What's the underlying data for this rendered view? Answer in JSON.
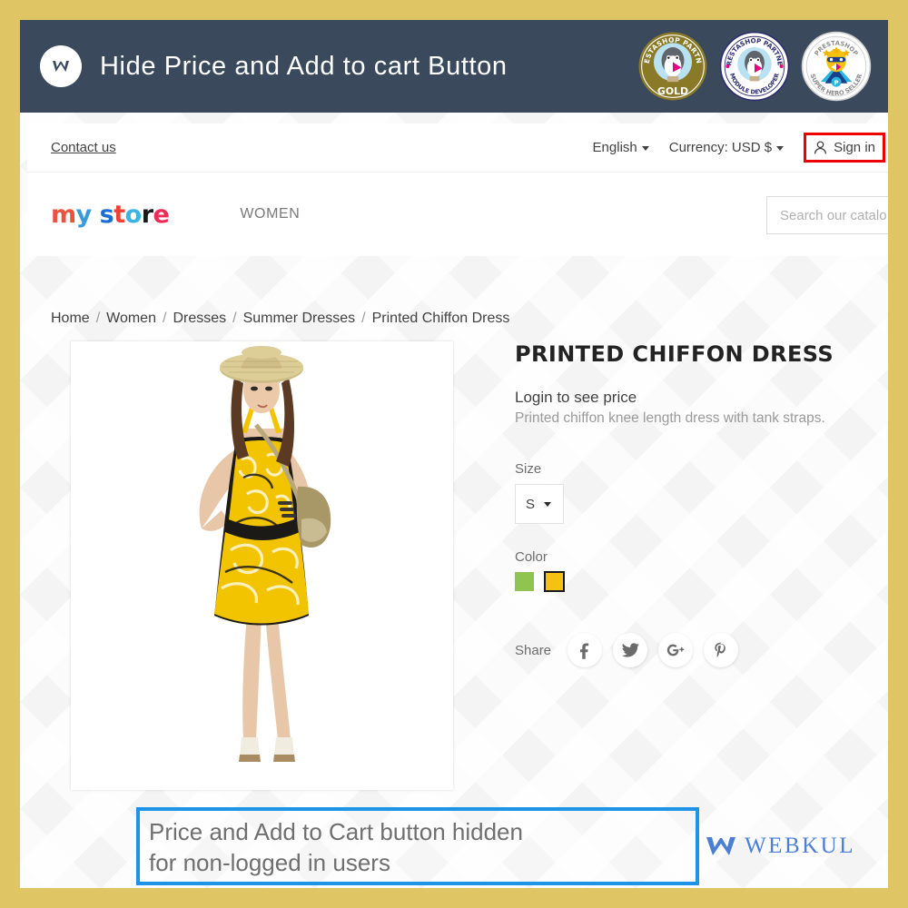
{
  "banner": {
    "title": "Hide Price and Add to cart Button",
    "logo_icon": "webkul-mark-icon",
    "badges": [
      {
        "name": "prestashop-partner-gold-badge",
        "line1": "PRESTASHOP PARTNER",
        "line2": "GOLD"
      },
      {
        "name": "prestashop-partner-module-developer-badge",
        "line1": "PRESTASHOP PARTNER",
        "line2": "MODULE DEVELOPER"
      },
      {
        "name": "prestashop-super-hero-seller-badge",
        "line1": "PRESTASHOP",
        "line2": "SUPER HERO SELLER"
      }
    ],
    "background_color": "#3a4a5c"
  },
  "frame": {
    "border_color": "#e0c565"
  },
  "topbar": {
    "contact_us": "Contact us",
    "language": "English",
    "currency": "Currency: USD $",
    "sign_in": "Sign in",
    "sign_in_highlight_color": "#ee0000"
  },
  "navrow": {
    "logo": {
      "full": "my store",
      "letters": [
        "m",
        "y",
        "s",
        "t",
        "o",
        "r",
        "e"
      ]
    },
    "menu": [
      "WOMEN"
    ],
    "search": {
      "placeholder": "Search our catalo",
      "value": ""
    }
  },
  "breadcrumb": {
    "items": [
      "Home",
      "Women",
      "Dresses",
      "Summer Dresses",
      "Printed Chiffon Dress"
    ],
    "separator": "/"
  },
  "product": {
    "title": "PRINTED CHIFFON DRESS",
    "price_message": "Login to see price",
    "description": "Printed chiffon knee length dress with tank straps.",
    "image_alt": "Model wearing printed yellow chiffon summer dress with straw hat",
    "size": {
      "label": "Size",
      "selected": "S"
    },
    "color": {
      "label": "Color",
      "options": [
        {
          "name": "green",
          "hex": "#8ec44f",
          "selected": false
        },
        {
          "name": "yellow",
          "hex": "#f5c211",
          "selected": true
        }
      ]
    },
    "share": {
      "label": "Share",
      "networks": [
        "facebook",
        "twitter",
        "google-plus",
        "pinterest"
      ]
    }
  },
  "annotation": {
    "text": "Price and Add to Cart button hidden\nfor non-logged in users",
    "border_color": "#1e94e8"
  },
  "footer": {
    "brand": "WEBKUL",
    "brand_color": "#4a7fd4"
  }
}
